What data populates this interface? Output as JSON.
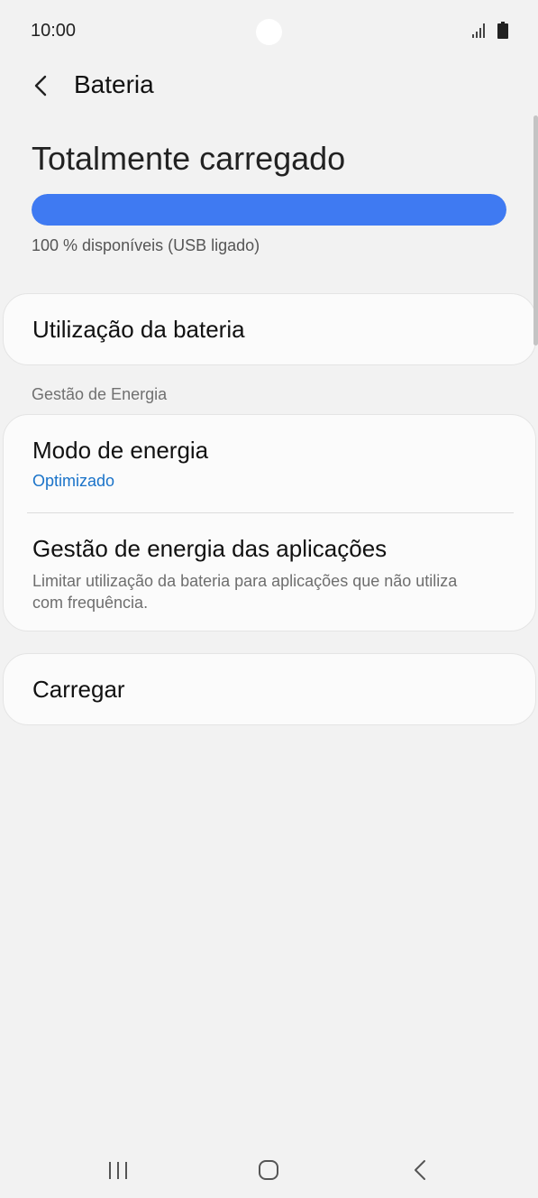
{
  "status_bar": {
    "time": "10:00"
  },
  "header": {
    "title": "Bateria"
  },
  "battery": {
    "headline": "Totalmente carregado",
    "level_percent": 100,
    "subtext": "100 % disponíveis (USB ligado)"
  },
  "usage_card": {
    "label": "Utilização da bateria"
  },
  "power_section": {
    "label": "Gestão de Energia",
    "power_mode": {
      "title": "Modo de energia",
      "value": "Optimizado"
    },
    "app_power": {
      "title": "Gestão de energia das aplicações",
      "description": "Limitar utilização da bateria para aplicações que não utiliza com frequência."
    }
  },
  "charging_card": {
    "label": "Carregar"
  },
  "colors": {
    "accent": "#3f7af2",
    "link": "#1a73c9",
    "background": "#f2f2f2"
  },
  "nav_bar": {
    "icons": [
      "recent-apps-icon",
      "home-icon",
      "back-icon"
    ]
  }
}
